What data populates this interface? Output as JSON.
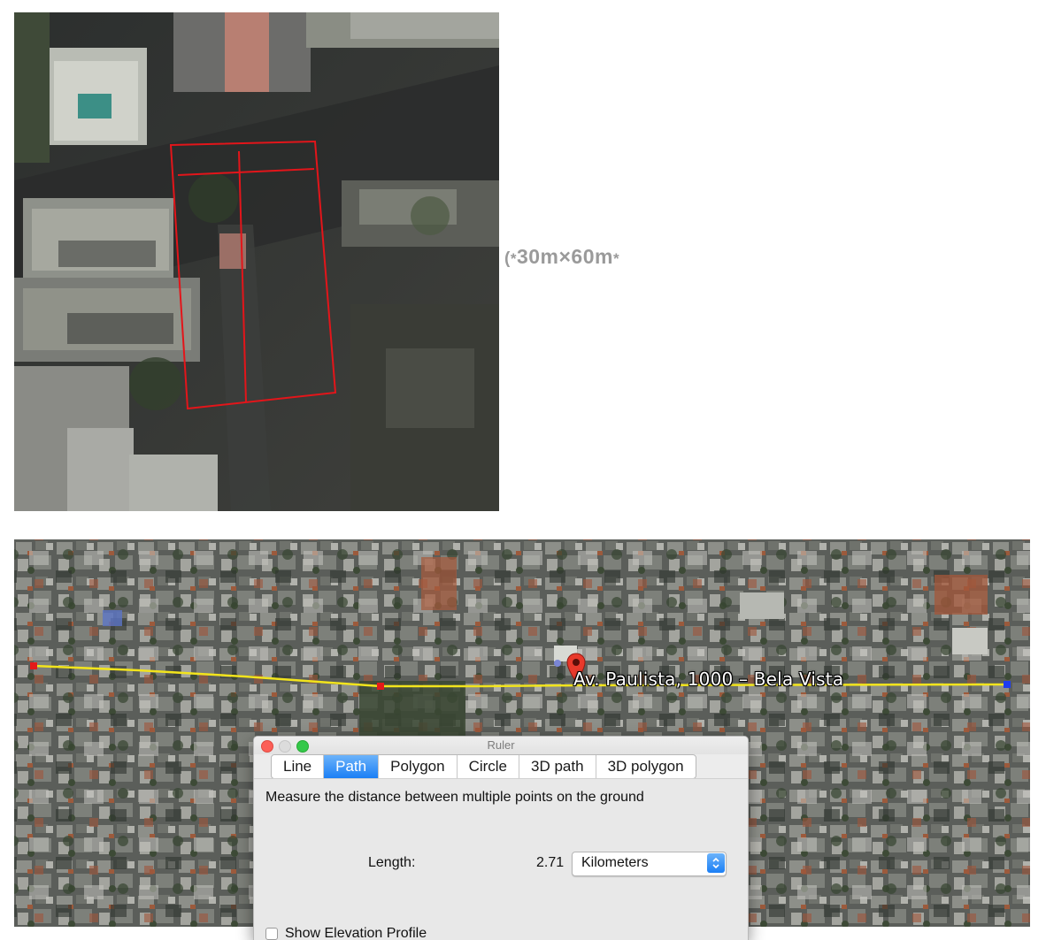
{
  "top_panel": {
    "caption_paren": "(",
    "caption_star": "*",
    "caption_text": "30m×60m",
    "outline_color": "#e3151a"
  },
  "map": {
    "place_label": "Av. Paulista, 1000 – Bela Vista",
    "path_color": "#f2e41c",
    "start_marker_color": "#e41a1a",
    "end_marker_color": "#1e3cf0",
    "pin_color": "#e8392b"
  },
  "ruler": {
    "title": "Ruler",
    "tabs": [
      {
        "label": "Line",
        "active": false
      },
      {
        "label": "Path",
        "active": true
      },
      {
        "label": "Polygon",
        "active": false
      },
      {
        "label": "Circle",
        "active": false
      },
      {
        "label": "3D path",
        "active": false
      },
      {
        "label": "3D polygon",
        "active": false
      }
    ],
    "description": "Measure the distance between multiple points on the ground",
    "length_label": "Length:",
    "length_value": "2.71",
    "unit": "Kilometers",
    "elevation_label": "Show Elevation Profile",
    "accent": "#1b7ff5"
  }
}
